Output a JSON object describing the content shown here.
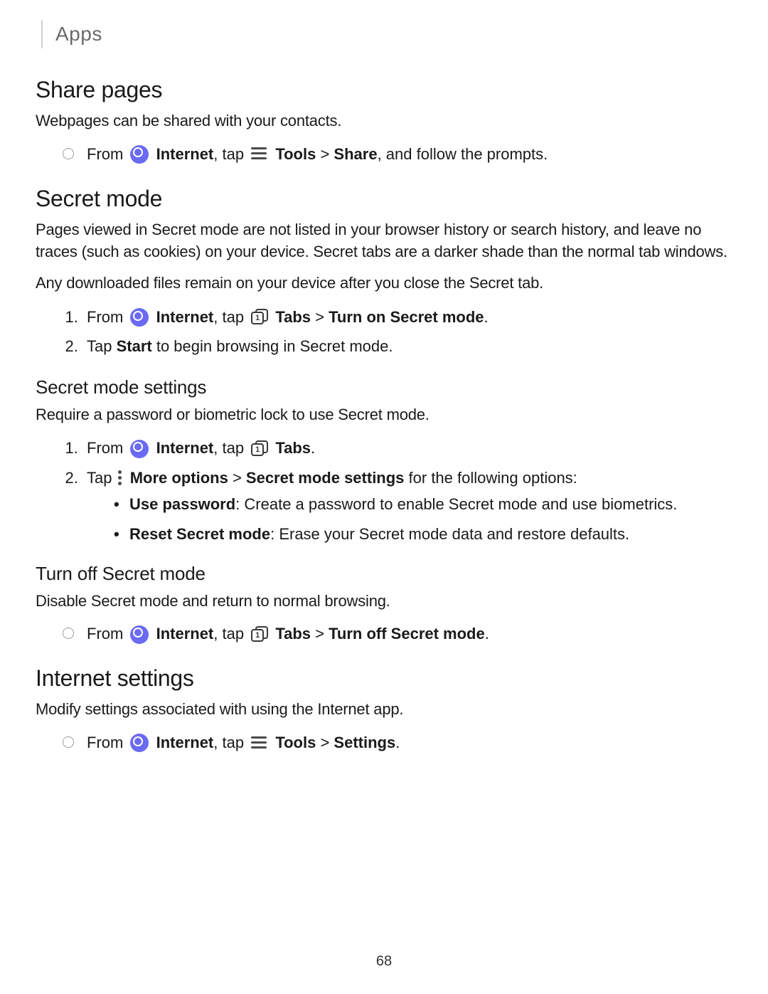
{
  "header": {
    "category": "Apps"
  },
  "share_pages": {
    "heading": "Share pages",
    "intro": "Webpages can be shared with your contacts.",
    "step_pre": "From ",
    "internet_label": "Internet",
    "tap": ", tap ",
    "tools_label": "Tools",
    "share_label": "Share",
    "step_post": ", and follow the prompts."
  },
  "secret_mode": {
    "heading": "Secret mode",
    "para1": "Pages viewed in Secret mode are not listed in your browser history or search history, and leave no traces (such as cookies) on your device. Secret tabs are a darker shade than the normal tab windows.",
    "para2": "Any downloaded files remain on your device after you close the Secret tab.",
    "step1_pre": "From ",
    "internet_label": "Internet",
    "tap": ", tap ",
    "tabs_label": "Tabs",
    "turn_on": "Turn on Secret mode",
    "step2_pre": "Tap ",
    "start_label": "Start",
    "step2_post": " to begin browsing in Secret mode."
  },
  "secret_settings": {
    "heading": "Secret mode settings",
    "intro": "Require a password or biometric lock to use Secret mode.",
    "step1_pre": "From ",
    "internet_label": "Internet",
    "tap": ", tap ",
    "tabs_label": "Tabs",
    "step2_pre": "Tap ",
    "more_label": "More options",
    "sms_label": "Secret mode settings",
    "step2_post": " for the following options:",
    "opt1_label": "Use password",
    "opt1_text": ": Create a password to enable Secret mode and use biometrics.",
    "opt2_label": "Reset Secret mode",
    "opt2_text": ": Erase your Secret mode data and restore defaults."
  },
  "turn_off": {
    "heading": "Turn off Secret mode",
    "intro": "Disable Secret mode and return to normal browsing.",
    "step_pre": "From ",
    "internet_label": "Internet",
    "tap": ", tap ",
    "tabs_label": "Tabs",
    "turn_off_label": "Turn off Secret mode"
  },
  "internet_settings": {
    "heading": "Internet settings",
    "intro": "Modify settings associated with using the Internet app.",
    "step_pre": "From ",
    "internet_label": "Internet",
    "tap": ", tap ",
    "tools_label": "Tools",
    "settings_label": "Settings"
  },
  "page_number": "68",
  "gt": " > "
}
